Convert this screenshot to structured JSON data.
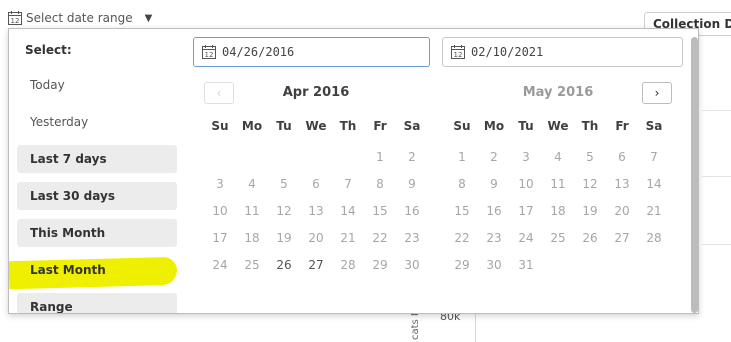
{
  "trigger": {
    "label": "Select date range"
  },
  "background": {
    "header": "Collection De",
    "axis_value": "80k",
    "vertical_text": "cats R"
  },
  "ranges": {
    "title": "Select:",
    "items": [
      {
        "label": "Today",
        "shaded": false
      },
      {
        "label": "Yesterday",
        "shaded": false
      },
      {
        "label": "Last 7 days",
        "shaded": true
      },
      {
        "label": "Last 30 days",
        "shaded": true
      },
      {
        "label": "This Month",
        "shaded": true
      },
      {
        "label": "Last Month",
        "shaded": true,
        "highlighted": true
      },
      {
        "label": "Range",
        "shaded": true
      }
    ]
  },
  "inputs": {
    "start": "04/26/2016",
    "end": "02/10/2021"
  },
  "weekdays": [
    "Su",
    "Mo",
    "Tu",
    "We",
    "Th",
    "Fr",
    "Sa"
  ],
  "calendars": [
    {
      "title": "Apr 2016",
      "title_style": "dark",
      "nav": {
        "prev": "‹",
        "prev_enabled": false
      },
      "weeks": [
        [
          null,
          null,
          null,
          null,
          null,
          1,
          2
        ],
        [
          3,
          4,
          5,
          6,
          7,
          8,
          9
        ],
        [
          10,
          11,
          12,
          13,
          14,
          15,
          16
        ],
        [
          17,
          18,
          19,
          20,
          21,
          22,
          23
        ],
        [
          24,
          25,
          26,
          27,
          28,
          29,
          30
        ]
      ],
      "enabled_days": [
        26,
        27
      ]
    },
    {
      "title": "May 2016",
      "title_style": "light",
      "nav": {
        "next": "›",
        "next_enabled": true
      },
      "weeks": [
        [
          1,
          2,
          3,
          4,
          5,
          6,
          7
        ],
        [
          8,
          9,
          10,
          11,
          12,
          13,
          14
        ],
        [
          15,
          16,
          17,
          18,
          19,
          20,
          21
        ],
        [
          22,
          23,
          24,
          25,
          26,
          27,
          28
        ],
        [
          29,
          30,
          31,
          null,
          null,
          null,
          null
        ]
      ],
      "enabled_days": []
    }
  ],
  "colors": {
    "highlight": "#eef000",
    "active_border": "#6c9bd2",
    "shaded_bg": "#ececec"
  }
}
